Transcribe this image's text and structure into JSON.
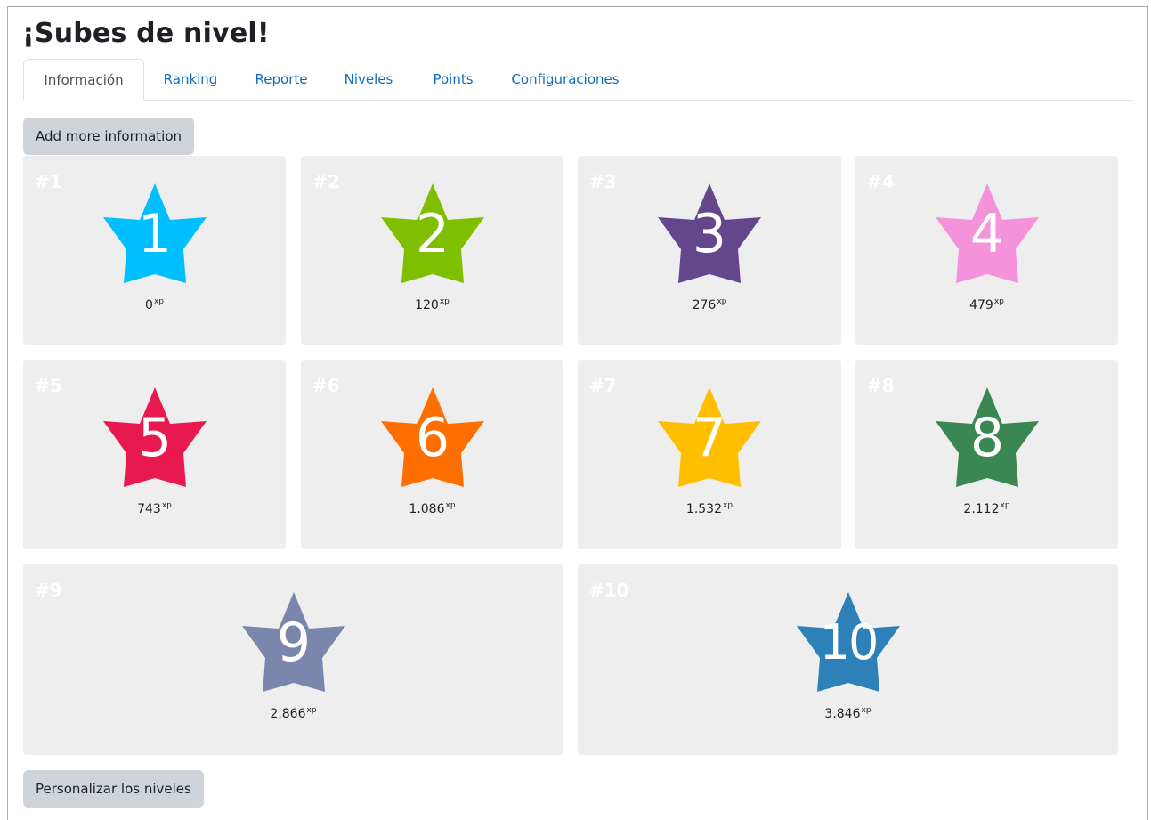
{
  "header": {
    "title": "¡Subes de nivel!"
  },
  "tabs": [
    {
      "label": "Información",
      "active": true
    },
    {
      "label": "Ranking",
      "active": false
    },
    {
      "label": "Reporte",
      "active": false
    },
    {
      "label": "Niveles",
      "active": false
    },
    {
      "label": "Points",
      "active": false
    },
    {
      "label": "Configuraciones",
      "active": false
    }
  ],
  "add_info_button": "Add more information",
  "customize_button": "Personalizar los niveles",
  "xp_suffix": "xp",
  "levels": [
    {
      "rank": "#1",
      "level": "1",
      "xp": "0",
      "color": "#00bfff"
    },
    {
      "rank": "#2",
      "level": "2",
      "xp": "120",
      "color": "#7fbf00"
    },
    {
      "rank": "#3",
      "level": "3",
      "xp": "276",
      "color": "#63468c"
    },
    {
      "rank": "#4",
      "level": "4",
      "xp": "479",
      "color": "#f592dc"
    },
    {
      "rank": "#5",
      "level": "5",
      "xp": "743",
      "color": "#e8194e"
    },
    {
      "rank": "#6",
      "level": "6",
      "xp": "1.086",
      "color": "#ff6f00"
    },
    {
      "rank": "#7",
      "level": "7",
      "xp": "1.532",
      "color": "#ffbf00"
    },
    {
      "rank": "#8",
      "level": "8",
      "xp": "2.112",
      "color": "#3b8751"
    },
    {
      "rank": "#9",
      "level": "9",
      "xp": "2.866",
      "color": "#7b86ad"
    },
    {
      "rank": "#10",
      "level": "10",
      "xp": "3.846",
      "color": "#2e80b8"
    }
  ]
}
